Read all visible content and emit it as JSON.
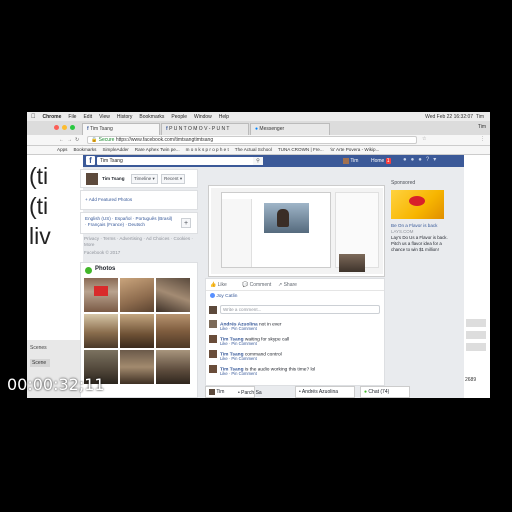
{
  "mac_menu": {
    "apple": "",
    "app": "Chrome",
    "items": [
      "File",
      "Edit",
      "View",
      "History",
      "Bookmarks",
      "People",
      "Window",
      "Help"
    ],
    "clock": "Wed Feb 22  16:32:07",
    "user": "Tim"
  },
  "tabs": [
    {
      "label": "Tim Tsang"
    },
    {
      "label": "P U N T O M O V - P U N T"
    },
    {
      "label": "Messenger"
    }
  ],
  "profile_badge": "Tim",
  "address": {
    "secure_label": "Secure",
    "url": "https://www.facebook.com/timtsangtimtsang"
  },
  "bookmarks": [
    "Apps",
    "Bookmarks",
    "SimpleAdder",
    "Rare Aphex Twin pe...",
    "m o n k s p r o p h e t",
    "The Actual School",
    "TUNA CROWN | Fre...",
    "'io' Arte Povera - Wikip..."
  ],
  "facebook": {
    "logo": "f",
    "search_value": "Tim Tsang",
    "user_name": "Tim",
    "home_label": "Home",
    "home_badge": "1"
  },
  "background_text": [
    "(ti",
    "(ti",
    "liv"
  ],
  "scenes_label": "Scenes",
  "scenes_item": "Scene",
  "profile": {
    "name": "Tim Tsang",
    "tab_timeline": "Timeline",
    "tab_recent": "Recent"
  },
  "sidebar": {
    "add_featured": "Add Featured Photos",
    "languages": "English (US) · Español · Português (Brasil) · Français (France) · Deutsch",
    "footer": "Privacy · Terms · Advertising · Ad Choices · Cookies · More",
    "copyright": "Facebook © 2017",
    "photos_title": "Photos"
  },
  "post": {
    "like": "Like",
    "comment": "Comment",
    "share": "Share",
    "liker": "Joy Catlin",
    "write_placeholder": "Write a comment...",
    "comments": [
      {
        "author": "Andrés Azuolina",
        "text": "not in ever",
        "sub": "Like · Pin Comment"
      },
      {
        "author": "Tim Tsang",
        "text": "waiting for skype call",
        "sub": "Like · Pin Comment"
      },
      {
        "author": "Tim Tsang",
        "text": "command control",
        "sub": "Like · Pin Comment"
      },
      {
        "author": "Tim Tsang",
        "text": "is the audio working this time? lol",
        "sub": "Like · Pin Comment"
      }
    ]
  },
  "sponsored": {
    "label": "Sponsored",
    "ad_title": "Be On a Flavor is back",
    "ad_domain": "LAYS.COM",
    "ad_text": "Lay's Do Us a Flavor is back. Pitch us a flavor idea for a chance to win $1 million!"
  },
  "chat": {
    "tab1": "Tim",
    "tab2": "Parch Sa",
    "tab3": "Andrés Azuolina",
    "tab4": "Chat (74)"
  },
  "timecode": "00:00:32;11",
  "corner_number": "2689",
  "colors": {
    "fb_blue": "#3b5998",
    "link": "#365899",
    "page_bg": "#e9ebee"
  }
}
